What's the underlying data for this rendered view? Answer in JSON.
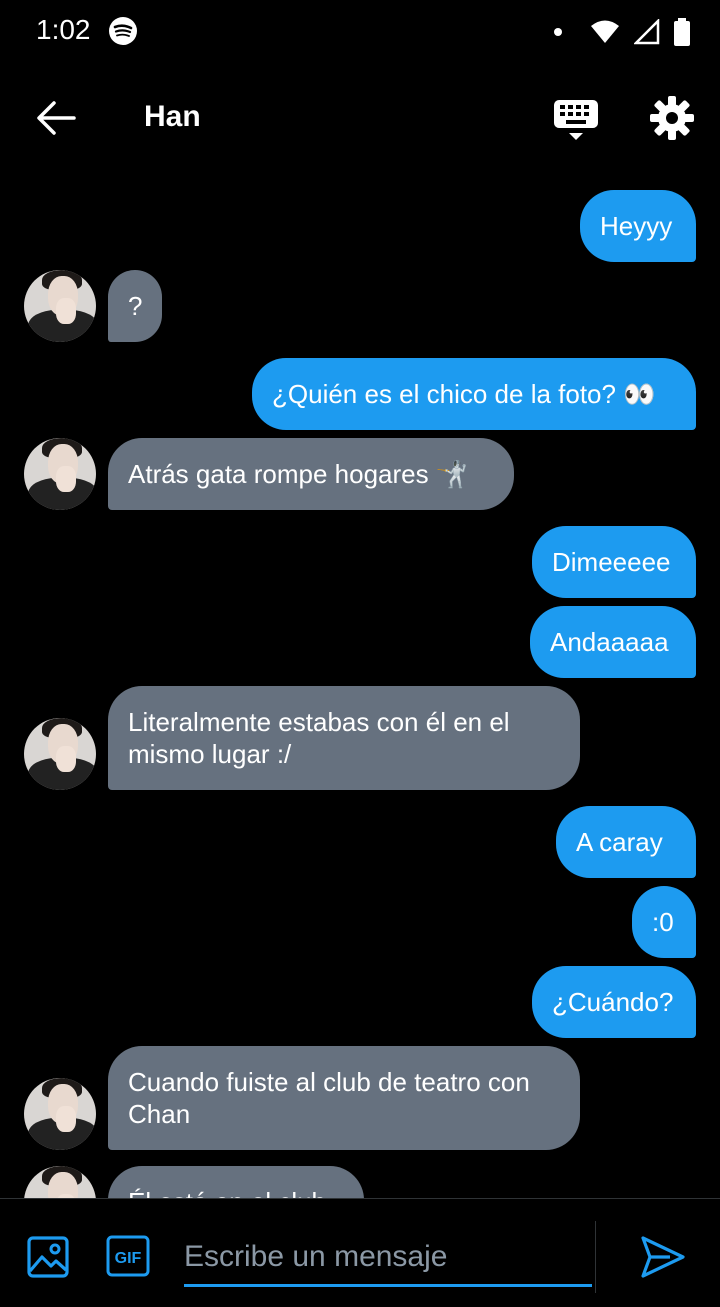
{
  "status_bar": {
    "time": "1:02",
    "icons": [
      "spotify-icon",
      "notification-dot",
      "wifi-icon",
      "signal-icon",
      "battery-icon"
    ]
  },
  "header": {
    "title": "Han",
    "icons": [
      "back-arrow-icon",
      "keyboard-icon",
      "gear-icon"
    ]
  },
  "colors": {
    "sent_bubble": "#1d9bf0",
    "received_bubble": "#66717f",
    "background": "#000000",
    "accent": "#1d9bf0"
  },
  "messages": [
    {
      "from": "me",
      "text": "Heyyy"
    },
    {
      "from": "contact",
      "text": "?"
    },
    {
      "from": "me",
      "text": "¿Quién es el chico de la foto? 👀"
    },
    {
      "from": "contact",
      "text": "Atrás gata rompe hogares 🤺"
    },
    {
      "from": "me",
      "text": "Dimeeeee"
    },
    {
      "from": "me",
      "text": "Andaaaaa"
    },
    {
      "from": "contact",
      "text": "Literalmente estabas con él en el mismo lugar :/"
    },
    {
      "from": "me",
      "text": "A caray"
    },
    {
      "from": "me",
      "text": ":0"
    },
    {
      "from": "me",
      "text": "¿Cuándo?"
    },
    {
      "from": "contact",
      "text": "Cuando fuiste al club de teatro con Chan"
    },
    {
      "from": "contact",
      "text": "Él está en el club"
    }
  ],
  "compose": {
    "placeholder": "Escribe un mensaje",
    "gif_label": "GIF",
    "icons": [
      "image-icon",
      "gif-icon",
      "send-icon"
    ]
  }
}
